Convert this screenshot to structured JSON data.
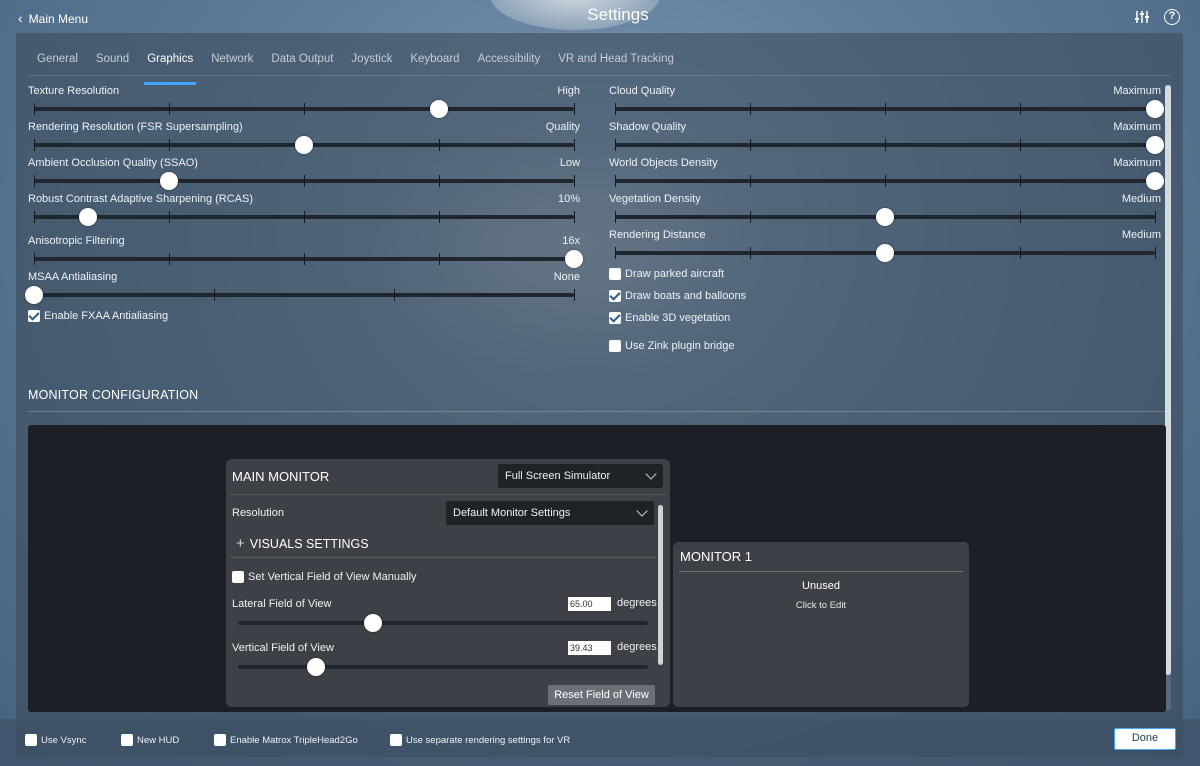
{
  "header": {
    "back_label": "Main Menu",
    "title": "Settings",
    "icons": [
      "sliders-icon",
      "help-icon"
    ],
    "help_glyph": "?"
  },
  "tabs": [
    {
      "label": "General",
      "active": false
    },
    {
      "label": "Sound",
      "active": false
    },
    {
      "label": "Graphics",
      "active": true
    },
    {
      "label": "Network",
      "active": false
    },
    {
      "label": "Data Output",
      "active": false
    },
    {
      "label": "Joystick",
      "active": false
    },
    {
      "label": "Keyboard",
      "active": false
    },
    {
      "label": "Accessibility",
      "active": false
    },
    {
      "label": "VR and Head Tracking",
      "active": false
    }
  ],
  "left_settings": [
    {
      "label": "Texture Resolution",
      "value": "High",
      "level": 0.75
    },
    {
      "label": "Rendering Resolution (FSR Supersampling)",
      "value": "Quality",
      "level": 0.5
    },
    {
      "label": "Ambient Occlusion Quality (SSAO)",
      "value": "Low",
      "level": 0.25
    },
    {
      "label": "Robust Contrast Adaptive Sharpening (RCAS)",
      "value": "10%",
      "level": 0.1
    },
    {
      "label": "Anisotropic Filtering",
      "value": "16x",
      "level": 1.0
    },
    {
      "label": "MSAA Antialiasing",
      "value": "None",
      "level": 0.0
    }
  ],
  "left_checkboxes": [
    {
      "label": "Enable FXAA Antialiasing",
      "checked": true
    }
  ],
  "right_settings": [
    {
      "label": "Cloud Quality",
      "value": "Maximum",
      "level": 1.0
    },
    {
      "label": "Shadow Quality",
      "value": "Maximum",
      "level": 1.0
    },
    {
      "label": "World Objects Density",
      "value": "Maximum",
      "level": 1.0
    },
    {
      "label": "Vegetation Density",
      "value": "Medium",
      "level": 0.5
    },
    {
      "label": "Rendering Distance",
      "value": "Medium",
      "level": 0.5
    }
  ],
  "right_checkboxes": [
    {
      "label": "Draw parked aircraft",
      "checked": false
    },
    {
      "label": "Draw boats and balloons",
      "checked": true
    },
    {
      "label": "Enable 3D vegetation",
      "checked": true
    },
    {
      "label": "Use Zink plugin bridge",
      "checked": false
    }
  ],
  "monitor_config": {
    "section_title": "MONITOR CONFIGURATION",
    "main_monitor": {
      "title": "MAIN MONITOR",
      "mode": "Full Screen Simulator",
      "resolution_label": "Resolution",
      "resolution_value": "Default Monitor Settings",
      "visuals_title": "VISUALS SETTINGS",
      "plus_glyph": "+",
      "vertical_fov_manual_label": "Set Vertical Field of View Manually",
      "vertical_fov_manual_checked": false,
      "lateral_fov_label": "Lateral Field of View",
      "lateral_fov_value": "65.00",
      "lateral_fov_level": 0.33,
      "vertical_fov_label": "Vertical Field of View",
      "vertical_fov_value": "39.43",
      "vertical_fov_level": 0.19,
      "degrees_label": "degrees",
      "reset_label": "Reset Field of View"
    },
    "monitor1": {
      "title": "MONITOR 1",
      "status": "Unused",
      "hint": "Click to Edit"
    }
  },
  "bottom_checkboxes": [
    {
      "label": "Use Vsync",
      "checked": false
    },
    {
      "label": "New HUD",
      "checked": false
    },
    {
      "label": "Enable Matrox TripleHead2Go",
      "checked": false
    },
    {
      "label": "Use separate rendering settings for VR",
      "checked": false
    }
  ],
  "done_label": "Done",
  "colors": {
    "accent": "#3fa7ff",
    "panel": "#3a4858",
    "track": "#1f262e"
  }
}
